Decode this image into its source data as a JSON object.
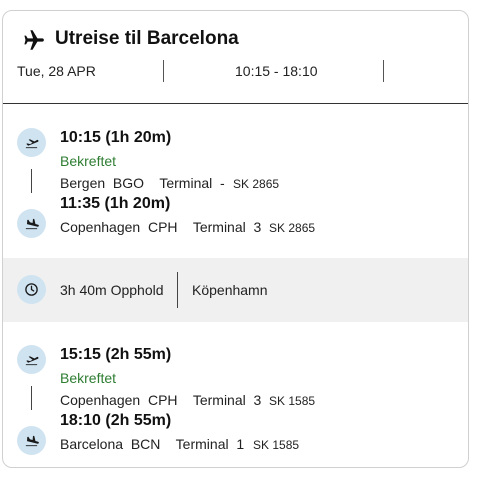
{
  "header": {
    "title": "Utreise til Barcelona",
    "date": "Tue, 28 APR",
    "time_range": "10:15 - 18:10",
    "icon": "airplane-icon"
  },
  "segments": [
    {
      "departure_time": "10:15  (1h 20m)",
      "status": "Bekreftet",
      "departure_place": "Bergen  BGO    Terminal  -",
      "departure_flight": "SK 2865",
      "arrival_time": "11:35  (1h 20m)",
      "arrival_place": "Copenhagen  CPH    Terminal  3",
      "arrival_flight": "SK 2865"
    },
    {
      "departure_time": "15:15  (2h 55m)",
      "status": "Bekreftet",
      "departure_place": "Copenhagen  CPH    Terminal  3",
      "departure_flight": "SK 1585",
      "arrival_time": "18:10  (2h 55m)",
      "arrival_place": "Barcelona  BCN    Terminal  1",
      "arrival_flight": "SK 1585"
    }
  ],
  "layover": {
    "duration": "3h 40m Opphold",
    "city": "Köpenhamn",
    "icon": "clock-icon"
  },
  "colors": {
    "status_green": "#2e7d32",
    "icon_bg": "#cfe3f1",
    "layover_bg": "#f0f0f0"
  }
}
